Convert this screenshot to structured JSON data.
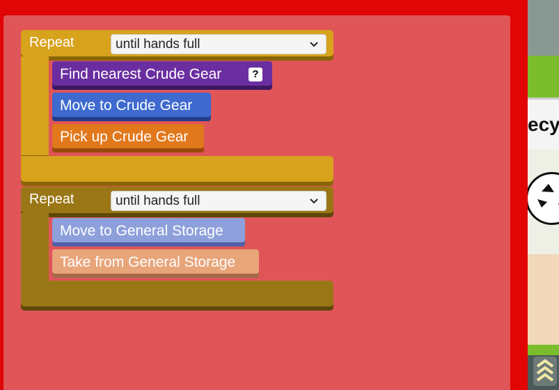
{
  "program": {
    "loops": [
      {
        "keyword": "Repeat",
        "condition": "until hands full",
        "color": "#d7a21c",
        "steps": [
          {
            "label": "Find nearest Crude Gear",
            "color": "#6a2ea0",
            "help": "?"
          },
          {
            "label": "Move to Crude Gear",
            "color": "#3e6ad0"
          },
          {
            "label": "Pick up Crude Gear",
            "color": "#e2781c"
          }
        ]
      },
      {
        "keyword": "Repeat",
        "condition": "until hands full",
        "color": "#9a7716",
        "steps": [
          {
            "label": "Move to General Storage",
            "color": "#8ea0db"
          },
          {
            "label": "Take from General Storage",
            "color": "#e8a57a"
          }
        ]
      }
    ]
  },
  "game_view": {
    "partial_title": "ecy",
    "icon": "recycle-icon"
  }
}
